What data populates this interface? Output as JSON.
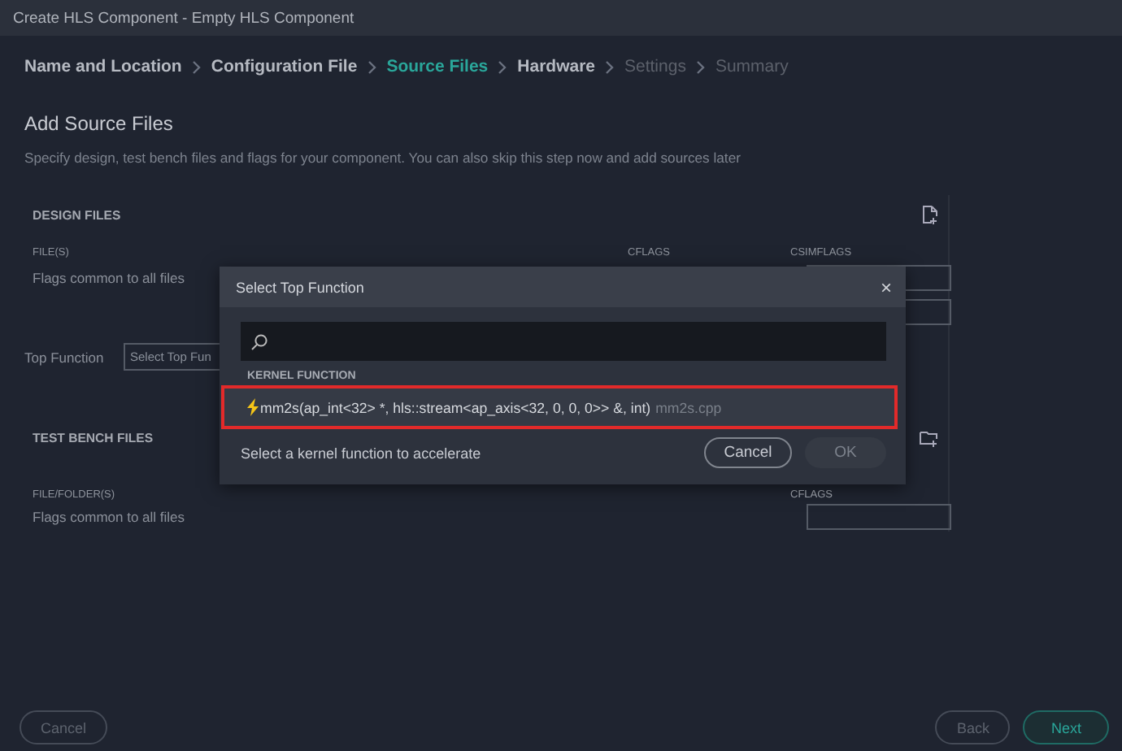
{
  "window": {
    "title": "Create HLS Component - Empty HLS Component"
  },
  "steps": [
    {
      "label": "Name and Location",
      "selected": false,
      "disabled": false
    },
    {
      "label": "Configuration File",
      "selected": false,
      "disabled": false
    },
    {
      "label": "Source Files",
      "selected": true,
      "disabled": false
    },
    {
      "label": "Hardware",
      "selected": false,
      "disabled": false
    },
    {
      "label": "Settings",
      "selected": false,
      "disabled": true
    },
    {
      "label": "Summary",
      "selected": false,
      "disabled": true
    }
  ],
  "heading": "Add Source Files",
  "description": "Specify design, test bench files and flags for your component. You can also skip this step now and add sources later",
  "design_files": {
    "title": "DESIGN FILES",
    "columns": [
      "FILE(S)",
      "CFLAGS",
      "CSIMFLAGS"
    ],
    "flags_label": "Flags common to all files",
    "top_function": {
      "label": "Top Function",
      "placeholder": "Select Top Fun"
    }
  },
  "test_bench_files": {
    "title": "TEST BENCH FILES",
    "column": "FILE/FOLDER(S)",
    "cflags": "CFLAGS",
    "flags_label": "Flags common to all files"
  },
  "dialog": {
    "title": "Select Top Function",
    "close": "×",
    "section": "KERNEL FUNCTION",
    "items": [
      {
        "signature": "mm2s(ap_int<32> *, hls::stream<ap_axis<32, 0, 0, 0>> &, int)",
        "file": "mm2s.cpp",
        "selected": true
      }
    ],
    "hint": "Select a kernel function to accelerate",
    "buttons": [
      {
        "label": "Cancel",
        "disabled": false
      },
      {
        "label": "OK",
        "disabled": true
      }
    ]
  },
  "footer": {
    "buttons": [
      {
        "label": "Cancel",
        "kind": "outline"
      },
      {
        "label": "Back",
        "kind": "outline"
      },
      {
        "label": "Next",
        "kind": "primary"
      }
    ]
  }
}
